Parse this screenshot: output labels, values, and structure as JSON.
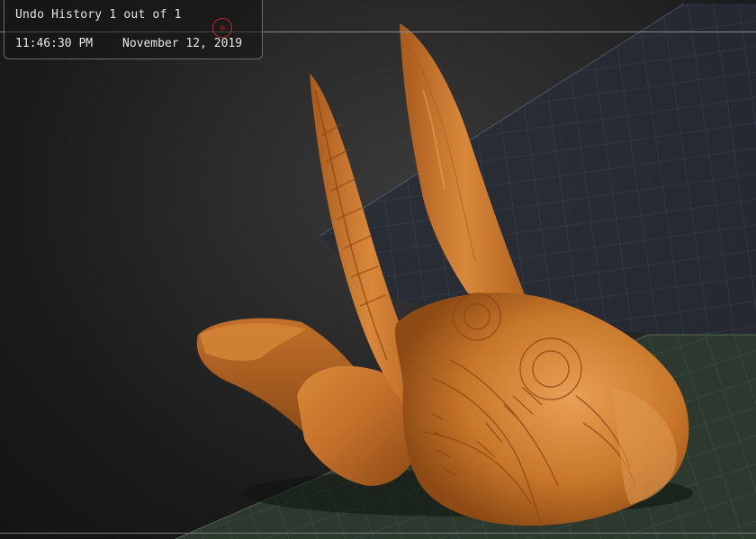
{
  "undo_history": {
    "title": "Undo History 1 out of 1",
    "time": "11:46:30 PM",
    "date": "November 12, 2019"
  },
  "viewport": {
    "model_color": "#c8772a",
    "grid_floor_color": "#3b4a3c",
    "grid_back_color": "#2d3342",
    "marker_color": "#c0282a"
  }
}
